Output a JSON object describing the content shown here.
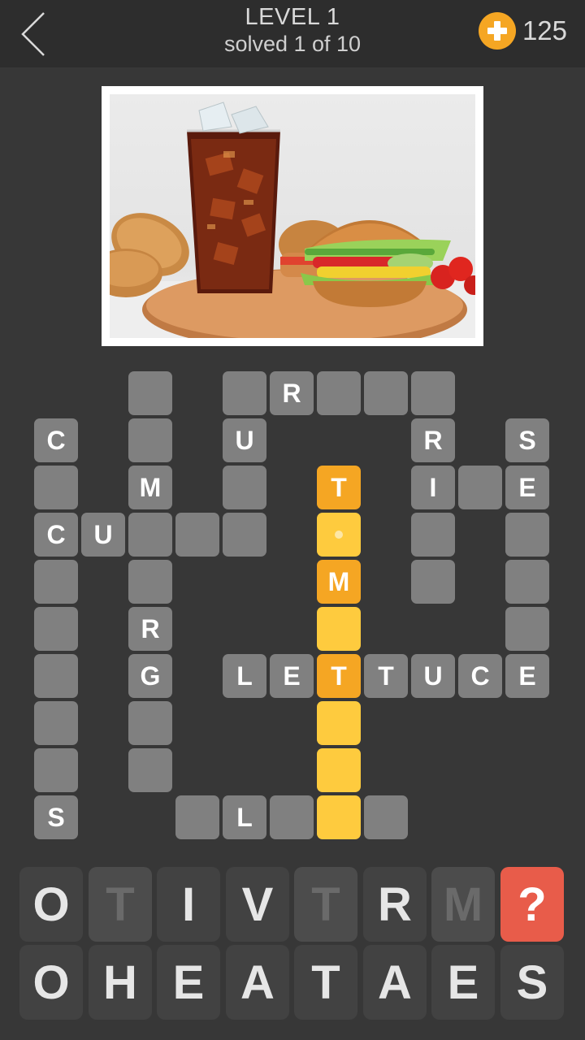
{
  "header": {
    "back_icon": "chevron-left-icon",
    "level_title": "LEVEL 1",
    "progress_text": "solved 1 of 10",
    "coin_icon": "plus-coin-icon",
    "coin_count": "125",
    "coin_color": "#f5a623"
  },
  "puzzle_image": {
    "description": "Glass of cola with ice next to a hamburger with lettuce, tomato and cucumber on a wooden board, buns and cherry tomatoes"
  },
  "colors": {
    "cell_default": "#808080",
    "cell_selected_letter": "#f5a623",
    "cell_selected_word": "#fecb3e",
    "hint_button": "#e85c4a"
  },
  "grid": {
    "cells": [
      {
        "row": 0,
        "col": 2,
        "letter": "",
        "state": "default"
      },
      {
        "row": 0,
        "col": 4,
        "letter": "",
        "state": "default"
      },
      {
        "row": 0,
        "col": 5,
        "letter": "R",
        "state": "default"
      },
      {
        "row": 0,
        "col": 6,
        "letter": "",
        "state": "default"
      },
      {
        "row": 0,
        "col": 7,
        "letter": "",
        "state": "default"
      },
      {
        "row": 0,
        "col": 8,
        "letter": "",
        "state": "default"
      },
      {
        "row": 1,
        "col": 0,
        "letter": "C",
        "state": "default"
      },
      {
        "row": 1,
        "col": 2,
        "letter": "",
        "state": "default"
      },
      {
        "row": 1,
        "col": 4,
        "letter": "U",
        "state": "default"
      },
      {
        "row": 1,
        "col": 8,
        "letter": "R",
        "state": "default"
      },
      {
        "row": 1,
        "col": 10,
        "letter": "S",
        "state": "default"
      },
      {
        "row": 2,
        "col": 0,
        "letter": "",
        "state": "default"
      },
      {
        "row": 2,
        "col": 2,
        "letter": "M",
        "state": "default"
      },
      {
        "row": 2,
        "col": 4,
        "letter": "",
        "state": "default"
      },
      {
        "row": 2,
        "col": 6,
        "letter": "T",
        "state": "hl-strong"
      },
      {
        "row": 2,
        "col": 8,
        "letter": "I",
        "state": "default"
      },
      {
        "row": 2,
        "col": 9,
        "letter": "",
        "state": "default"
      },
      {
        "row": 2,
        "col": 10,
        "letter": "E",
        "state": "default"
      },
      {
        "row": 3,
        "col": 0,
        "letter": "C",
        "state": "default"
      },
      {
        "row": 3,
        "col": 1,
        "letter": "U",
        "state": "default"
      },
      {
        "row": 3,
        "col": 2,
        "letter": "",
        "state": "default"
      },
      {
        "row": 3,
        "col": 3,
        "letter": "",
        "state": "default"
      },
      {
        "row": 3,
        "col": 4,
        "letter": "",
        "state": "default"
      },
      {
        "row": 3,
        "col": 6,
        "letter": "",
        "state": "hl-light",
        "cursor": true
      },
      {
        "row": 3,
        "col": 8,
        "letter": "",
        "state": "default"
      },
      {
        "row": 3,
        "col": 10,
        "letter": "",
        "state": "default"
      },
      {
        "row": 4,
        "col": 0,
        "letter": "",
        "state": "default"
      },
      {
        "row": 4,
        "col": 2,
        "letter": "",
        "state": "default"
      },
      {
        "row": 4,
        "col": 6,
        "letter": "M",
        "state": "hl-strong"
      },
      {
        "row": 4,
        "col": 8,
        "letter": "",
        "state": "default"
      },
      {
        "row": 4,
        "col": 10,
        "letter": "",
        "state": "default"
      },
      {
        "row": 5,
        "col": 0,
        "letter": "",
        "state": "default"
      },
      {
        "row": 5,
        "col": 2,
        "letter": "R",
        "state": "default"
      },
      {
        "row": 5,
        "col": 6,
        "letter": "",
        "state": "hl-light"
      },
      {
        "row": 5,
        "col": 10,
        "letter": "",
        "state": "default"
      },
      {
        "row": 6,
        "col": 0,
        "letter": "",
        "state": "default"
      },
      {
        "row": 6,
        "col": 2,
        "letter": "G",
        "state": "default"
      },
      {
        "row": 6,
        "col": 4,
        "letter": "L",
        "state": "default"
      },
      {
        "row": 6,
        "col": 5,
        "letter": "E",
        "state": "default"
      },
      {
        "row": 6,
        "col": 6,
        "letter": "T",
        "state": "hl-strong"
      },
      {
        "row": 6,
        "col": 7,
        "letter": "T",
        "state": "default"
      },
      {
        "row": 6,
        "col": 8,
        "letter": "U",
        "state": "default"
      },
      {
        "row": 6,
        "col": 9,
        "letter": "C",
        "state": "default"
      },
      {
        "row": 6,
        "col": 10,
        "letter": "E",
        "state": "default"
      },
      {
        "row": 7,
        "col": 0,
        "letter": "",
        "state": "default"
      },
      {
        "row": 7,
        "col": 2,
        "letter": "",
        "state": "default"
      },
      {
        "row": 7,
        "col": 6,
        "letter": "",
        "state": "hl-light"
      },
      {
        "row": 8,
        "col": 0,
        "letter": "",
        "state": "default"
      },
      {
        "row": 8,
        "col": 2,
        "letter": "",
        "state": "default"
      },
      {
        "row": 8,
        "col": 6,
        "letter": "",
        "state": "hl-light"
      },
      {
        "row": 9,
        "col": 0,
        "letter": "S",
        "state": "default"
      },
      {
        "row": 9,
        "col": 3,
        "letter": "",
        "state": "default"
      },
      {
        "row": 9,
        "col": 4,
        "letter": "L",
        "state": "default"
      },
      {
        "row": 9,
        "col": 5,
        "letter": "",
        "state": "default"
      },
      {
        "row": 9,
        "col": 6,
        "letter": "",
        "state": "hl-light"
      },
      {
        "row": 9,
        "col": 7,
        "letter": "",
        "state": "default"
      }
    ]
  },
  "keyboard": {
    "rows": [
      [
        {
          "letter": "O",
          "used": false
        },
        {
          "letter": "T",
          "used": true
        },
        {
          "letter": "I",
          "used": false
        },
        {
          "letter": "V",
          "used": false
        },
        {
          "letter": "T",
          "used": true
        },
        {
          "letter": "R",
          "used": false
        },
        {
          "letter": "M",
          "used": true
        },
        {
          "letter": "?",
          "hint": true
        }
      ],
      [
        {
          "letter": "O",
          "used": false
        },
        {
          "letter": "H",
          "used": false
        },
        {
          "letter": "E",
          "used": false
        },
        {
          "letter": "A",
          "used": false
        },
        {
          "letter": "T",
          "used": false
        },
        {
          "letter": "A",
          "used": false
        },
        {
          "letter": "E",
          "used": false
        },
        {
          "letter": "S",
          "used": false
        }
      ]
    ]
  }
}
